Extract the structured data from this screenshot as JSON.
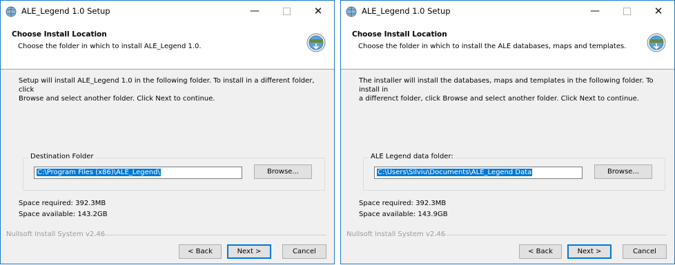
{
  "dialogs": [
    {
      "window_title": "ALE_Legend 1.0 Setup",
      "header_title": "Choose Install Location",
      "header_subtitle": "Choose the folder in which to install ALE_Legend 1.0.",
      "intro_line1": "Setup will install ALE_Legend 1.0 in the following folder. To install in a different folder, click",
      "intro_line2": "Browse and select another folder. Click Next to continue.",
      "group_label": "Destination Folder",
      "path_value": "C:\\Program Files (x86)\\ALE_Legend\\",
      "browse_label": "Browse...",
      "space_required": "Space required: 392.3MB",
      "space_available": "Space available: 143.2GB",
      "branding": "Nullsoft Install System v2.46",
      "back_label": "< Back",
      "next_label": "Next >",
      "cancel_label": "Cancel"
    },
    {
      "window_title": "ALE_Legend 1.0 Setup",
      "header_title": "Choose Install Location",
      "header_subtitle": "Choose the folder in which to install the ALE databases, maps and templates.",
      "intro_line1": "The installer will install the databases, maps and templates in the following folder. To install in",
      "intro_line2": "a differenct folder, click Browse and select another folder. Click Next to continue.",
      "group_label": "ALE Legend data folder:",
      "path_value": "C:\\Users\\Silviu\\Documents\\ALE_Legend Data",
      "browse_label": "Browse...",
      "space_required": "Space required: 392.3MB",
      "space_available": "Space available: 143.9GB",
      "branding": "Nullsoft Install System v2.46",
      "back_label": "< Back",
      "next_label": "Next >",
      "cancel_label": "Cancel"
    }
  ],
  "caption_buttons": {
    "minimize": "—",
    "close": "✕"
  },
  "icons": {
    "app": "installer-globe-icon",
    "header_logo": "nsis-installer-logo-icon"
  },
  "colors": {
    "selection": "#0078d7",
    "window_border": "#1c79c8",
    "dialog_bg": "#f0f0f0"
  }
}
